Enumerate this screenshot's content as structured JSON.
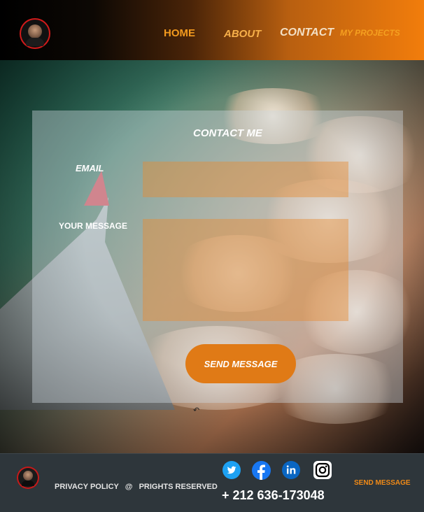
{
  "header": {
    "nav": {
      "home": "HOME",
      "about": "ABOUT",
      "contact": "CONTACT",
      "projects": "MY PROJECTS"
    }
  },
  "contact_form": {
    "title": "CONTACT ME",
    "email_label": "EMAIL",
    "email_value": "",
    "message_label": "YOUR MESSAGE",
    "message_value": "",
    "submit_label": "SEND MESSAGE"
  },
  "footer": {
    "privacy_label": "PRIVACY POLICY",
    "at_symbol": "@",
    "rights_label": "PRIGHTS RESERVED",
    "phone": "+ 212 636-173048",
    "send_label": "SEND MESSAGE",
    "social_icons": [
      "twitter-icon",
      "facebook-icon",
      "linkedin-icon",
      "instagram-icon"
    ]
  },
  "colors": {
    "accent": "#e07a16",
    "nav_orange": "#f39a1e",
    "footer_bg": "#2e363b"
  }
}
